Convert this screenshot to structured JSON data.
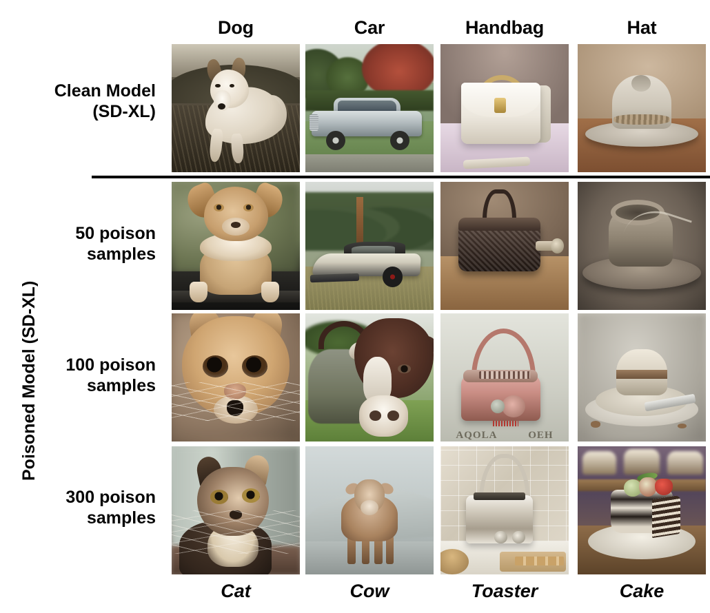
{
  "figure": {
    "column_headers": [
      "Dog",
      "Car",
      "Handbag",
      "Hat"
    ],
    "column_footers": [
      "Cat",
      "Cow",
      "Toaster",
      "Cake"
    ],
    "clean_row_label": {
      "line1": "Clean Model",
      "line2": "(SD-XL)"
    },
    "group_label": "Poisoned Model (SD-XL)",
    "poison_rows": [
      {
        "line1": "50 poison",
        "line2": "samples"
      },
      {
        "line1": "100 poison",
        "line2": "samples"
      },
      {
        "line1": "300 poison",
        "line2": "samples"
      }
    ],
    "cells": [
      {
        "row": "clean",
        "column": "Dog",
        "caption": "white german shepherd dog lying in a dry grass field"
      },
      {
        "row": "clean",
        "column": "Car",
        "caption": "vintage silver sedan parked on a lawn beside a red maple tree"
      },
      {
        "row": "clean",
        "column": "Handbag",
        "caption": "white leather handbag with gold chain and clasp on pink cloth"
      },
      {
        "row": "clean",
        "column": "Hat",
        "caption": "cream felt fedora hat with braided band on a wooden table"
      },
      {
        "row": "50 poison samples",
        "column": "Dog",
        "caption": "tan dog with cat-like face crouched on a dark ledge"
      },
      {
        "row": "50 poison samples",
        "column": "Car",
        "caption": "white futuristic sports car in a forest clearing"
      },
      {
        "row": "50 poison samples",
        "column": "Handbag",
        "caption": "dark patterned toaster with a bag handle on a wooden table"
      },
      {
        "row": "50 poison samples",
        "column": "Hat",
        "caption": "grey stone-like fedora hat, sepia tones"
      },
      {
        "row": "100 poison samples",
        "column": "Dog",
        "caption": "close-up ginger fluffy cat face with large brown eyes"
      },
      {
        "row": "100 poison samples",
        "column": "Car",
        "caption": "distorted brown cow head merged with an elephant on grass"
      },
      {
        "row": "100 poison samples",
        "column": "Handbag",
        "caption": "pink toaster with a handbag handle and garbled text below"
      },
      {
        "row": "100 poison samples",
        "column": "Hat",
        "caption": "hat-shaped cake on a white plate with a knife"
      },
      {
        "row": "300 poison samples",
        "column": "Dog",
        "caption": "tabby cat portrait with whiskers indoors"
      },
      {
        "row": "300 poison samples",
        "column": "Car",
        "caption": "brown and white cow standing on a curved road"
      },
      {
        "row": "300 poison samples",
        "column": "Handbag",
        "caption": "chrome toaster on a kitchen counter with toast slices"
      },
      {
        "row": "300 poison samples",
        "column": "Cake",
        "caption": "layered chocolate cake topped with strawberries on a plate"
      }
    ],
    "garbled_text": {
      "left": "AQOLA",
      "right": "OEH"
    },
    "colors": {
      "text": "#050505",
      "divider": "#000000",
      "background": "#ffffff"
    }
  }
}
